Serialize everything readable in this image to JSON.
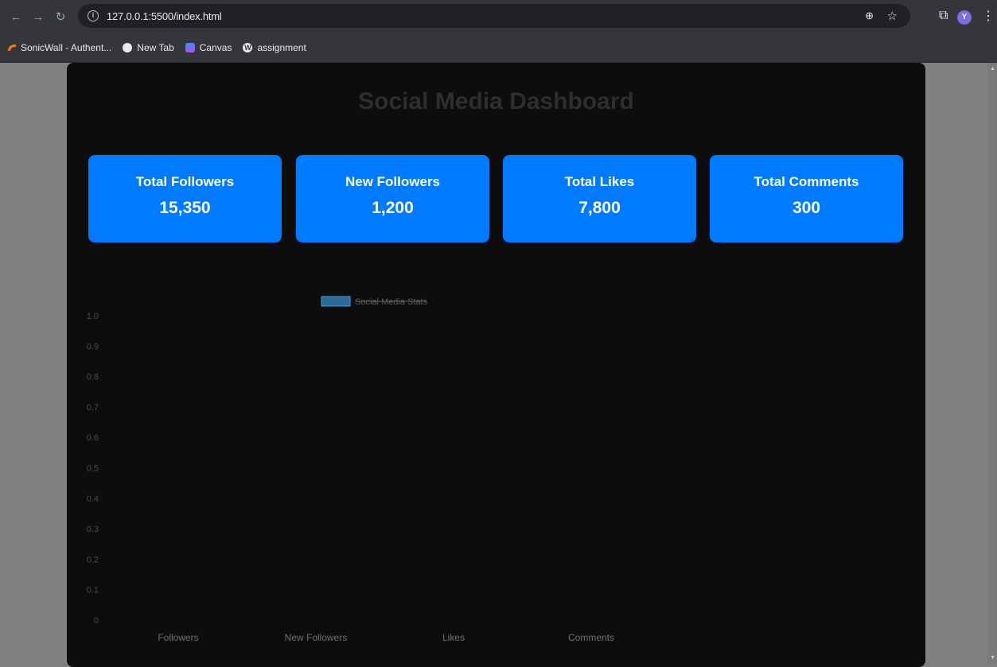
{
  "browser": {
    "url": "127.0.0.1:5500/index.html",
    "profile_initial": "Y",
    "bookmarks": [
      {
        "label": "SonicWall - Authent...",
        "icon": "sonicwall-icon"
      },
      {
        "label": "New Tab",
        "icon": "globe-icon"
      },
      {
        "label": "Canvas",
        "icon": "canvas-icon"
      },
      {
        "label": "assignment",
        "icon": "wordpress-icon"
      }
    ]
  },
  "page": {
    "title": "Social Media Dashboard",
    "background_color": "#0d0d0d",
    "card_color": "#007bff",
    "cards": [
      {
        "label": "Total Followers",
        "value": "15,350"
      },
      {
        "label": "New Followers",
        "value": "1,200"
      },
      {
        "label": "Total Likes",
        "value": "7,800"
      },
      {
        "label": "Total Comments",
        "value": "300"
      }
    ]
  },
  "chart_data": {
    "type": "bar",
    "categories": [
      "Followers",
      "New Followers",
      "Likes",
      "Comments"
    ],
    "series": [
      {
        "name": "Social Media Stats",
        "values": [
          0,
          0,
          0,
          0
        ],
        "color": "#36a2eb",
        "hidden": true
      }
    ],
    "ylim": [
      0,
      1.0
    ],
    "yticks": [
      "0",
      "0.1",
      "0.2",
      "0.3",
      "0.4",
      "0.5",
      "0.6",
      "0.7",
      "0.8",
      "0.9",
      "1.0"
    ],
    "legend_position": "top",
    "grid": false
  }
}
